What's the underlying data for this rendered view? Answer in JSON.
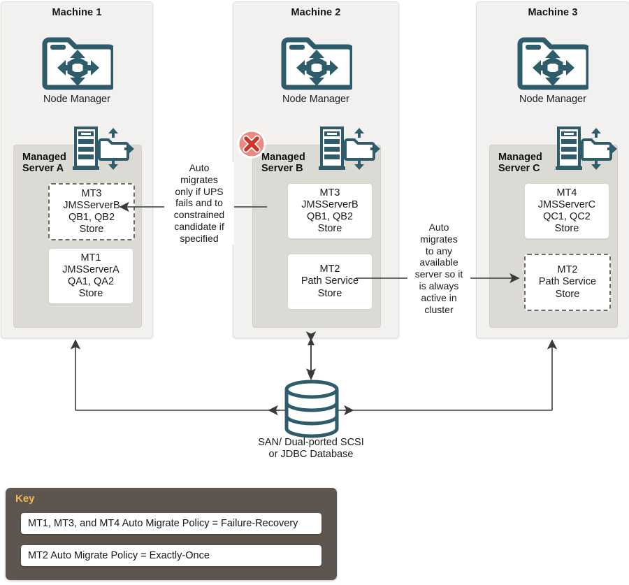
{
  "diagram": {
    "title": "WebLogic JMS automatic service migration across machines",
    "accent_teal": "#2e5c6b",
    "error_red": "#e8756a",
    "key_bg": "#5d554e",
    "key_title_color": "#f3b94f",
    "panel_bg": "#f2f1ef",
    "subpanel_bg": "#dcdad5"
  },
  "machines": [
    {
      "title": "Machine 1",
      "node_manager_label": "Node Manager",
      "node_manager_icon": "folder-migration-icon",
      "server_icon": "server-rack-folder-icon",
      "failed": false,
      "server": {
        "name": "Managed\nServer A",
        "name_line1": "Managed",
        "name_line2": "Server A",
        "targets": [
          {
            "style": "dashed",
            "lines": [
              "MT3",
              "JMSServerB",
              "QB1, QB2",
              "Store"
            ]
          },
          {
            "style": "solid",
            "lines": [
              "MT1",
              "JMSServerA",
              "QA1, QA2",
              "Store"
            ]
          }
        ]
      }
    },
    {
      "title": "Machine 2",
      "node_manager_label": "Node Manager",
      "node_manager_icon": "folder-migration-icon",
      "server_icon": "server-rack-folder-icon",
      "failed": true,
      "failure_badge_icon": "error-x-circle-icon",
      "server": {
        "name_line1": "Managed",
        "name_line2": "Server B",
        "targets": [
          {
            "style": "solid",
            "lines": [
              "MT3",
              "JMSServerB",
              "QB1, QB2",
              "Store"
            ]
          },
          {
            "style": "solid",
            "lines": [
              "MT2",
              "Path Service",
              "Store"
            ]
          }
        ]
      }
    },
    {
      "title": "Machine 3",
      "node_manager_label": "Node Manager",
      "node_manager_icon": "folder-migration-icon",
      "server_icon": "server-rack-folder-icon",
      "failed": false,
      "server": {
        "name_line1": "Managed",
        "name_line2": "Server C",
        "targets": [
          {
            "style": "solid",
            "lines": [
              "MT4",
              "JMSServerC",
              "QC1, QC2",
              "Store"
            ]
          },
          {
            "style": "dashed",
            "lines": [
              "MT2",
              "Path Service",
              "Store"
            ]
          }
        ]
      }
    }
  ],
  "annotations": [
    {
      "id": "annotation-mt3-migration",
      "lines": [
        "Auto",
        "migrates",
        "only if UPS",
        "fails and to",
        "constrained",
        "candidate if",
        "specified"
      ]
    },
    {
      "id": "annotation-mt2-migration",
      "lines": [
        "Auto",
        "migrates",
        "to any",
        "available",
        "server so it",
        "is always",
        "active in",
        "cluster"
      ]
    }
  ],
  "storage": {
    "icon": "database-cylinder-icon",
    "label_line1": "SAN/ Dual-ported SCSI",
    "label_line2": "or JDBC Database"
  },
  "key": {
    "title": "Key",
    "rows": [
      "MT1, MT3, and MT4 Auto Migrate Policy = Failure-Recovery",
      "MT2 Auto Migrate Policy = Exactly-Once"
    ]
  }
}
